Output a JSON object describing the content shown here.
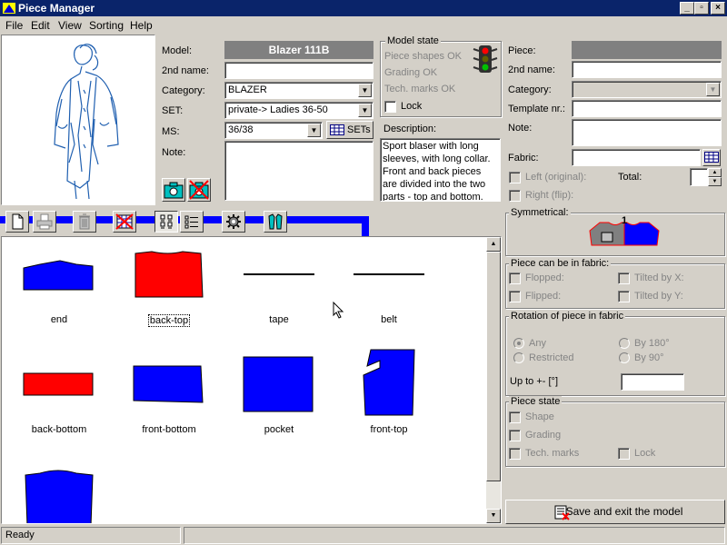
{
  "window": {
    "title": "Piece Manager"
  },
  "menu": [
    "File",
    "Edit",
    "View",
    "Sorting",
    "Help"
  ],
  "model": {
    "model_label": "Model:",
    "model_value": "Blazer 111B",
    "second_name_label": "2nd name:",
    "second_name_value": "",
    "category_label": "Category:",
    "category_value": "BLAZER",
    "set_label": "SET:",
    "set_value": "private-> Ladies 36-50",
    "ms_label": "MS:",
    "ms_value": "36/38",
    "sets_button": "SETs",
    "note_label": "Note:",
    "note_value": ""
  },
  "model_state": {
    "title": "Model state",
    "items": [
      "Piece shapes OK",
      "Grading OK",
      "Tech. marks OK"
    ],
    "lock_label": "Lock"
  },
  "description": {
    "label": "Description:",
    "text": "Sport blaser with long sleeves, with long collar. Front and back pieces are divided into the two parts - top and bottom. Arround"
  },
  "piece": {
    "piece_label": "Piece:",
    "second_name_label": "2nd name:",
    "category_label": "Category:",
    "template_label": "Template nr.:",
    "note_label": "Note:",
    "fabric_label": "Fabric:",
    "left_label": "Left (original):",
    "right_label": "Right (flip):",
    "total_label": "Total:"
  },
  "symmetrical": {
    "title": "Symmetrical:",
    "number": "1"
  },
  "fabric_pos": {
    "title": "Piece can be in fabric:",
    "flopped": "Flopped:",
    "flipped": "Flipped:",
    "tilted_x": "Tilted by X:",
    "tilted_y": "Tilted by Y:"
  },
  "rotation": {
    "title": "Rotation of piece in fabric",
    "any": "Any",
    "restricted": "Restricted",
    "by180": "By 180°",
    "by90": "By 90°",
    "upto_label": "Up to +- [°]",
    "upto_value": ""
  },
  "piece_state": {
    "title": "Piece state",
    "shape": "Shape",
    "grading": "Grading",
    "tech": "Tech. marks",
    "lock": "Lock"
  },
  "save_button": "Save and exit the model",
  "pieces": [
    {
      "name": "end",
      "color": "#0000ff"
    },
    {
      "name": "back-top",
      "color": "#ff0000"
    },
    {
      "name": "tape",
      "color": "#000000"
    },
    {
      "name": "belt",
      "color": "#000000"
    },
    {
      "name": "back-bottom",
      "color": "#ff0000"
    },
    {
      "name": "front-bottom",
      "color": "#0000ff"
    },
    {
      "name": "pocket",
      "color": "#0000ff"
    },
    {
      "name": "front-top",
      "color": "#0000ff"
    },
    {
      "name": "",
      "color": "#0000ff"
    }
  ],
  "status": {
    "text": "Ready"
  },
  "colors": {
    "title_bar": "#0a246a",
    "piece_blue": "#0000ff",
    "piece_red": "#ff0000",
    "model_field": "#808080"
  }
}
